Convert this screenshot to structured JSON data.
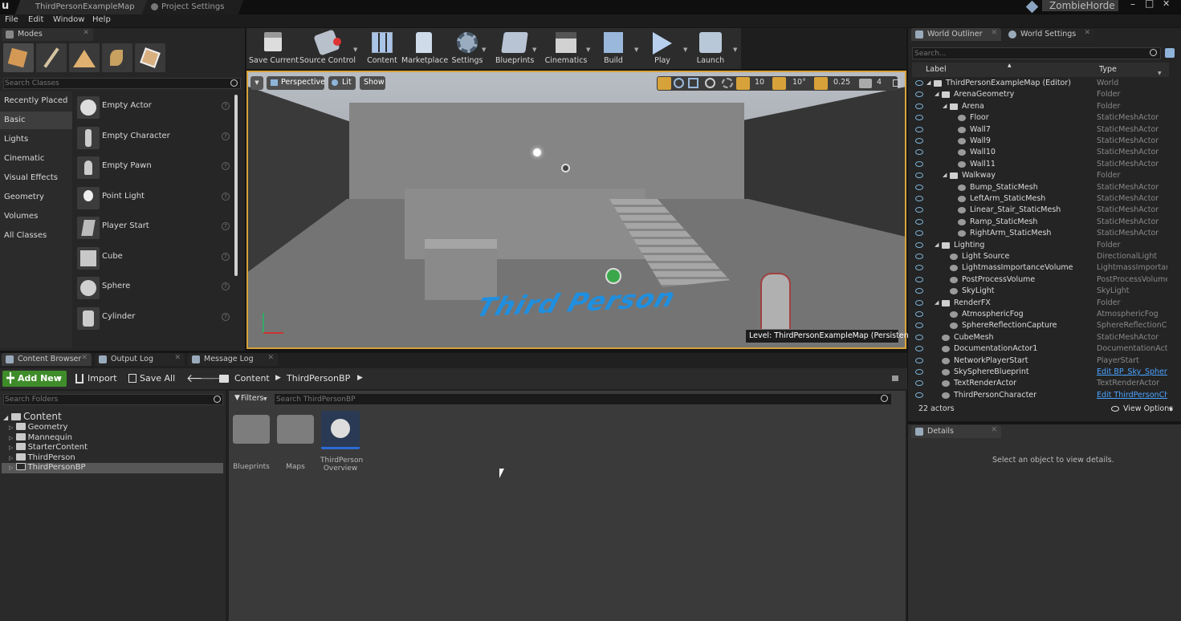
{
  "window": {
    "tabs": [
      "ThirdPersonExampleMap",
      "Project Settings"
    ],
    "project": "ZombieHorde",
    "controls": [
      "–",
      "□",
      "✕"
    ]
  },
  "menu": [
    "File",
    "Edit",
    "Window",
    "Help"
  ],
  "modes": {
    "tab": "Modes",
    "search_placeholder": "Search Classes",
    "categories": [
      "Recently Placed",
      "Basic",
      "Lights",
      "Cinematic",
      "Visual Effects",
      "Geometry",
      "Volumes",
      "All Classes"
    ],
    "selected_category": "Basic",
    "items": [
      "Empty Actor",
      "Empty Character",
      "Empty Pawn",
      "Point Light",
      "Player Start",
      "Cube",
      "Sphere",
      "Cylinder"
    ]
  },
  "toolbar": [
    "Save Current",
    "Source Control",
    "Content",
    "Marketplace",
    "Settings",
    "Blueprints",
    "Cinematics",
    "Build",
    "Play",
    "Launch"
  ],
  "viewport": {
    "buttons": [
      "Perspective",
      "Lit",
      "Show"
    ],
    "grid_snap": "10",
    "rot_snap": "10°",
    "scale_snap": "0.25",
    "speed": "4",
    "floor_text": "Third Person",
    "level_label": "Level:  ThirdPersonExampleMap (Persistent)"
  },
  "bottom_tabs": [
    "Content Browser",
    "Output Log",
    "Message Log"
  ],
  "content_browser": {
    "add_new": "Add New",
    "import": "Import",
    "save_all": "Save All",
    "path": [
      "Content",
      "ThirdPersonBP"
    ],
    "search_folders_placeholder": "Search Folders",
    "filters": "Filters",
    "search_assets_placeholder": "Search ThirdPersonBP",
    "tree_root": "Content",
    "tree": [
      "Geometry",
      "Mannequin",
      "StarterContent",
      "ThirdPerson",
      "ThirdPersonBP"
    ],
    "selected": "ThirdPersonBP",
    "assets": [
      {
        "name": "Blueprints",
        "kind": "folder"
      },
      {
        "name": "Maps",
        "kind": "folder"
      },
      {
        "name": "ThirdPerson Overview",
        "kind": "tutorial"
      }
    ]
  },
  "outliner": {
    "tab": "World Outliner",
    "tab2": "World Settings",
    "search_placeholder": "Search...",
    "col_label": "Label",
    "col_type": "Type",
    "rows": [
      {
        "label": "ThirdPersonExampleMap (Editor)",
        "type": "World",
        "indent": 0
      },
      {
        "label": "ArenaGeometry",
        "type": "Folder",
        "indent": 1
      },
      {
        "label": "Arena",
        "type": "Folder",
        "indent": 2
      },
      {
        "label": "Floor",
        "type": "StaticMeshActor",
        "indent": 3
      },
      {
        "label": "Wall7",
        "type": "StaticMeshActor",
        "indent": 3
      },
      {
        "label": "Wall9",
        "type": "StaticMeshActor",
        "indent": 3
      },
      {
        "label": "Wall10",
        "type": "StaticMeshActor",
        "indent": 3
      },
      {
        "label": "Wall11",
        "type": "StaticMeshActor",
        "indent": 3
      },
      {
        "label": "Walkway",
        "type": "Folder",
        "indent": 2
      },
      {
        "label": "Bump_StaticMesh",
        "type": "StaticMeshActor",
        "indent": 3
      },
      {
        "label": "LeftArm_StaticMesh",
        "type": "StaticMeshActor",
        "indent": 3
      },
      {
        "label": "Linear_Stair_StaticMesh",
        "type": "StaticMeshActor",
        "indent": 3
      },
      {
        "label": "Ramp_StaticMesh",
        "type": "StaticMeshActor",
        "indent": 3
      },
      {
        "label": "RightArm_StaticMesh",
        "type": "StaticMeshActor",
        "indent": 3
      },
      {
        "label": "Lighting",
        "type": "Folder",
        "indent": 1
      },
      {
        "label": "Light Source",
        "type": "DirectionalLight",
        "indent": 2
      },
      {
        "label": "LightmassImportanceVolume",
        "type": "LightmassImportanc",
        "indent": 2
      },
      {
        "label": "PostProcessVolume",
        "type": "PostProcessVolume",
        "indent": 2
      },
      {
        "label": "SkyLight",
        "type": "SkyLight",
        "indent": 2
      },
      {
        "label": "RenderFX",
        "type": "Folder",
        "indent": 1
      },
      {
        "label": "AtmosphericFog",
        "type": "AtmosphericFog",
        "indent": 2
      },
      {
        "label": "SphereReflectionCapture",
        "type": "SphereReflectionCap",
        "indent": 2
      },
      {
        "label": "CubeMesh",
        "type": "StaticMeshActor",
        "indent": 1
      },
      {
        "label": "DocumentationActor1",
        "type": "DocumentationActor",
        "indent": 1
      },
      {
        "label": "NetworkPlayerStart",
        "type": "PlayerStart",
        "indent": 1
      },
      {
        "label": "SkySphereBlueprint",
        "type": "Edit BP_Sky_Sphere",
        "indent": 1,
        "link": true
      },
      {
        "label": "TextRenderActor",
        "type": "TextRenderActor",
        "indent": 1
      },
      {
        "label": "ThirdPersonCharacter",
        "type": "Edit ThirdPersonCh",
        "indent": 1,
        "link": true
      }
    ],
    "count": "22 actors",
    "view_options": "View Options"
  },
  "details": {
    "tab": "Details",
    "empty": "Select an object to view details."
  },
  "colors": {
    "accent": "#d8a23a",
    "link": "#4aa3ff",
    "add_new": "#3f8c2a",
    "floor_text": "#1f8fe0"
  }
}
